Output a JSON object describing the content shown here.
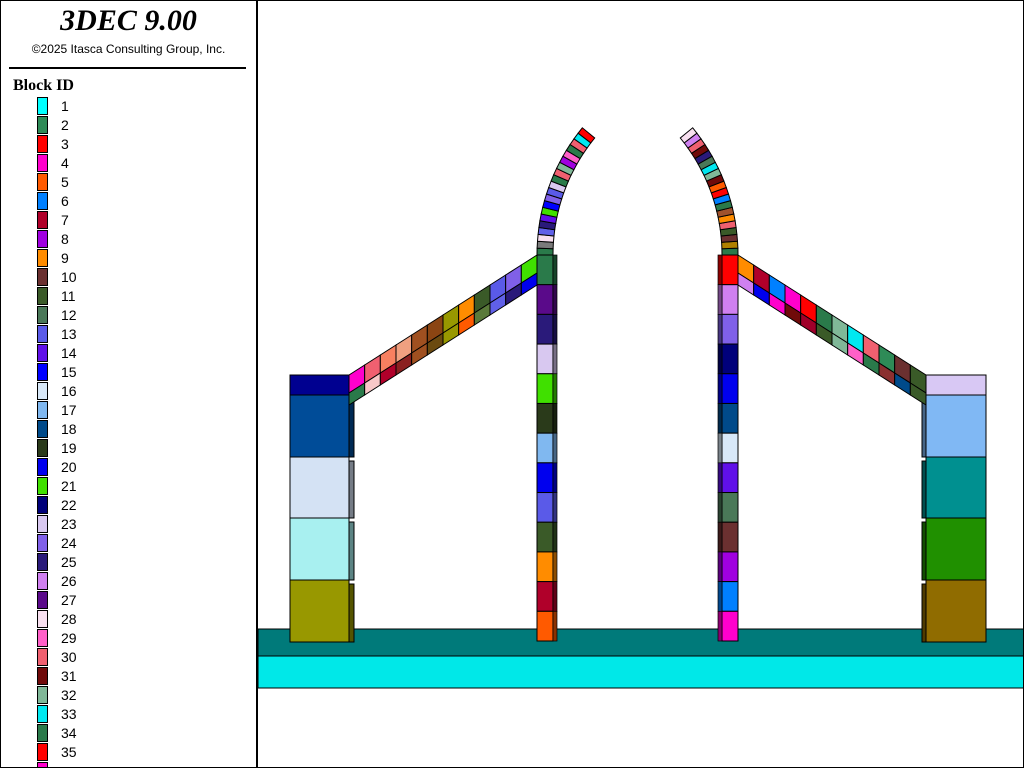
{
  "app": {
    "title": "3DEC 9.00",
    "copyright": "©2025 Itasca Consulting Group, Inc."
  },
  "legend": {
    "title": "Block  ID",
    "items": [
      {
        "label": "1",
        "color": "#00ffff"
      },
      {
        "label": "2",
        "color": "#2e8b57"
      },
      {
        "label": "3",
        "color": "#ff0000"
      },
      {
        "label": "4",
        "color": "#ff00cc"
      },
      {
        "label": "5",
        "color": "#ff5a00"
      },
      {
        "label": "6",
        "color": "#0080ff"
      },
      {
        "label": "7",
        "color": "#b0002a"
      },
      {
        "label": "8",
        "color": "#a000e0"
      },
      {
        "label": "9",
        "color": "#ff8c00"
      },
      {
        "label": "10",
        "color": "#6b3030"
      },
      {
        "label": "11",
        "color": "#3a5a28"
      },
      {
        "label": "12",
        "color": "#4a7858"
      },
      {
        "label": "13",
        "color": "#5a5ae8"
      },
      {
        "label": "14",
        "color": "#6010e8"
      },
      {
        "label": "15",
        "color": "#0000ff"
      },
      {
        "label": "16",
        "color": "#d8e8f8"
      },
      {
        "label": "17",
        "color": "#80b8f0"
      },
      {
        "label": "18",
        "color": "#004a8a"
      },
      {
        "label": "19",
        "color": "#2a3a1a"
      },
      {
        "label": "20",
        "color": "#0000ee"
      },
      {
        "label": "21",
        "color": "#40e000"
      },
      {
        "label": "22",
        "color": "#00007a"
      },
      {
        "label": "23",
        "color": "#d8c8f0"
      },
      {
        "label": "24",
        "color": "#8060e8"
      },
      {
        "label": "25",
        "color": "#2a1a7a"
      },
      {
        "label": "26",
        "color": "#d080f0"
      },
      {
        "label": "27",
        "color": "#5a0a8a"
      },
      {
        "label": "28",
        "color": "#f8e0f0"
      },
      {
        "label": "29",
        "color": "#ff60c8"
      },
      {
        "label": "30",
        "color": "#f06070"
      },
      {
        "label": "31",
        "color": "#700a0a"
      },
      {
        "label": "32",
        "color": "#80b898"
      },
      {
        "label": "33",
        "color": "#00e8f0"
      },
      {
        "label": "34",
        "color": "#2a7a4a"
      },
      {
        "label": "35",
        "color": "#ff0000"
      }
    ]
  },
  "model": {
    "base_colors": {
      "slab_top": "#007a7a",
      "slab_bottom": "#00e8e8"
    },
    "left_pillar": [
      "#000090",
      "#004c98",
      "#d4e2f4",
      "#a8f0f0",
      "#989800"
    ],
    "right_pillar": [
      "#d8c8f4",
      "#80b8f4",
      "#009090",
      "#209000",
      "#906c00"
    ],
    "left_column": [
      "#2a7a4a",
      "#5a0a8a",
      "#2a1a7a",
      "#d8c8f0",
      "#40e000",
      "#2a3a1a",
      "#80b8f0",
      "#0000ee",
      "#5a5ae8",
      "#3a5a28",
      "#ff8c00",
      "#b0002a",
      "#ff5a00"
    ],
    "right_column": [
      "#ff0000",
      "#d080f0",
      "#8060e8",
      "#00007a",
      "#0000ee",
      "#004a8a",
      "#d8e8f8",
      "#6010e8",
      "#4a7858",
      "#6b3030",
      "#a000e0",
      "#0080ff",
      "#ff00cc"
    ],
    "left_arch_voussoirs": [
      "#2a7a4a",
      "#7a7a7a",
      "#f8e0f0",
      "#6060e8",
      "#2a1a7a",
      "#6010e8",
      "#40e000",
      "#0000ff",
      "#8060e8",
      "#5a5ae8",
      "#d8c8f0",
      "#2a7a4a",
      "#f06070",
      "#80b898",
      "#a000e0",
      "#ff60c8",
      "#2a7a4a",
      "#f06070",
      "#00e8f0",
      "#ff0000"
    ],
    "right_arch_voussoirs": [
      "#2a7a4a",
      "#b08000",
      "#6b3030",
      "#3a5a28",
      "#f06070",
      "#ff8c00",
      "#a0522d",
      "#2a7a4a",
      "#0080ff",
      "#ff0000",
      "#ff5a00",
      "#700a0a",
      "#80b898",
      "#00e8f0",
      "#4a7858",
      "#2a1a7a",
      "#700a0a",
      "#f06070",
      "#d080f0",
      "#f8e0f0"
    ],
    "left_rafter": [
      "#ff00cc",
      "#f06070",
      "#f88060",
      "#f0a080",
      "#a05020",
      "#8b4513",
      "#989800",
      "#ff8c00",
      "#3a5a28",
      "#5a5ae8",
      "#8060e8",
      "#40e000"
    ],
    "right_rafter": [
      "#ff8c00",
      "#b0002a",
      "#0080ff",
      "#ff00cc",
      "#ff0000",
      "#2a7a4a",
      "#80b898",
      "#00e8f0",
      "#f06070",
      "#2e8b57",
      "#6b3030",
      "#3a5a28"
    ],
    "left_rafter_under": [
      "#2a7a4a",
      "#f8c8c8",
      "#b0002a",
      "#8b2020",
      "#a05020",
      "#6b4a10",
      "#989800",
      "#ff5a00",
      "#5a7a3a",
      "#6060e8",
      "#2a1a7a",
      "#0000ee"
    ],
    "right_rafter_under": [
      "#d080f0",
      "#0000ee",
      "#ff00cc",
      "#700a0a",
      "#a0002a",
      "#3a5a28",
      "#80b898",
      "#ff60c8",
      "#2a7a4a",
      "#8b3030",
      "#004a8a",
      "#3a5a28"
    ]
  }
}
